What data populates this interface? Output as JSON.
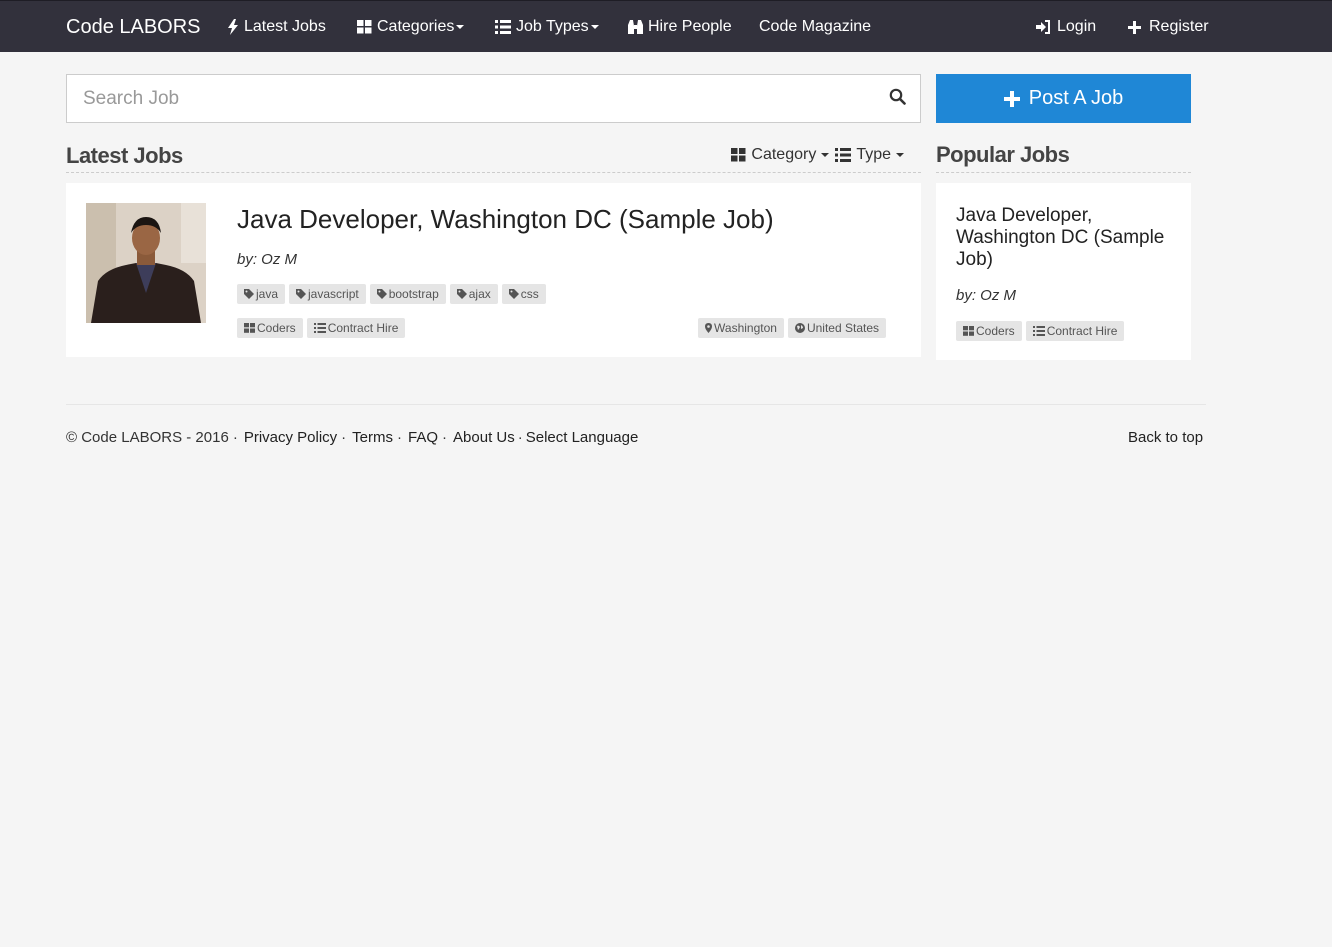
{
  "navbar": {
    "brand": "Code LABORS",
    "items": [
      {
        "label": "Latest Jobs",
        "icon": "bolt-icon"
      },
      {
        "label": "Categories",
        "icon": "grid-icon"
      },
      {
        "label": "Job Types",
        "icon": "list-icon"
      },
      {
        "label": "Hire People",
        "icon": "binoculars-icon"
      },
      {
        "label": "Code Magazine",
        "icon": ""
      }
    ],
    "login": "Login",
    "register": "Register"
  },
  "search": {
    "placeholder": "Search Job",
    "value": ""
  },
  "post_job": {
    "label": "Post A Job"
  },
  "latest": {
    "title": "Latest Jobs",
    "filter_category": "Category",
    "filter_type": "Type",
    "jobs": [
      {
        "title": "Java Developer, Washington DC (Sample Job)",
        "author": "by: Oz M",
        "skills": [
          "java",
          "javascript",
          "bootstrap",
          "ajax",
          "css"
        ],
        "category": "Coders",
        "type": "Contract Hire",
        "city": "Washington",
        "country": "United States"
      }
    ]
  },
  "popular": {
    "title": "Popular Jobs",
    "jobs": [
      {
        "title": "Java Developer, Washington DC (Sample Job)",
        "author": "by: Oz M",
        "category": "Coders",
        "type": "Contract Hire"
      }
    ]
  },
  "footer": {
    "copyright": "© Code LABORS - 2016",
    "links": [
      "Privacy Policy",
      "Terms",
      "FAQ",
      "About Us"
    ],
    "language": "Select Language",
    "back_to_top": "Back to top"
  },
  "colors": {
    "navbar_bg": "#32313c",
    "accent_blue": "#1f87d6",
    "page_bg": "#f5f5f5",
    "tag_bg": "#e5e5e5"
  }
}
